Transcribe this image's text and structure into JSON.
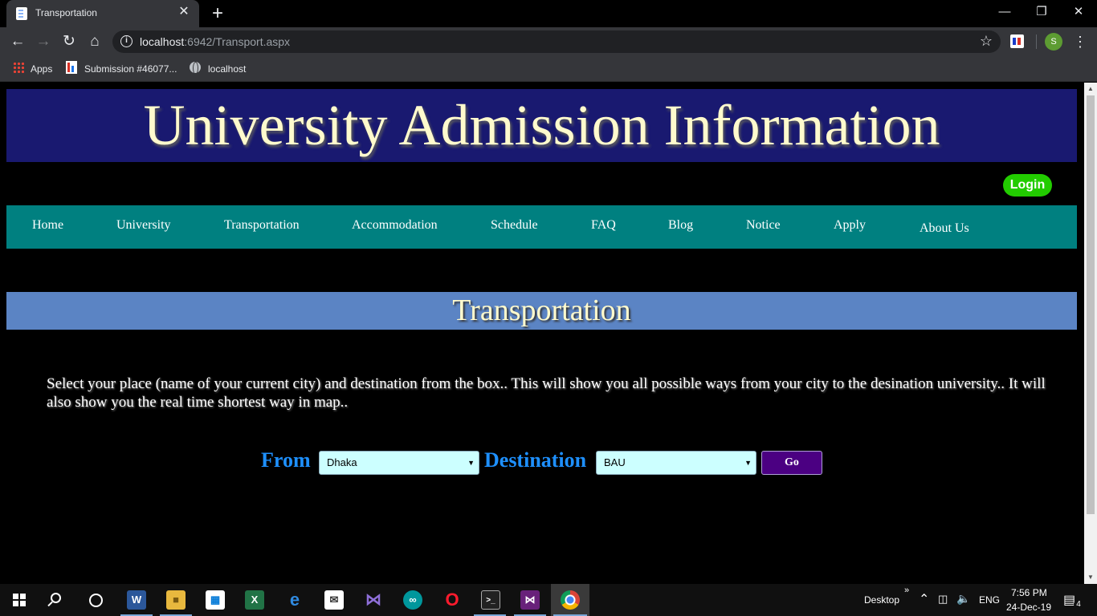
{
  "browser": {
    "tab_title": "Transportation",
    "tab_close": "✕",
    "new_tab": "+",
    "url_host": "localhost",
    "url_rest": ":6942/Transport.aspx",
    "bookmarks": {
      "apps": "Apps",
      "submission": "Submission #46077...",
      "localhost": "localhost"
    },
    "profile_initial": "S"
  },
  "page": {
    "banner_title": "University Admission Information",
    "login_label": "Login",
    "menu": [
      {
        "label": "Home"
      },
      {
        "label": "University"
      },
      {
        "label": "Transportation"
      },
      {
        "label": "Accommodation"
      },
      {
        "label": "Schedule"
      },
      {
        "label": "FAQ"
      },
      {
        "label": "Blog"
      },
      {
        "label": "Notice"
      },
      {
        "label": "Apply"
      },
      {
        "label": "About Us"
      }
    ],
    "section_title": "Transportation",
    "description": "Select your place (name of your current city) and destination from the box.. This will show you all possible ways from your city to the desination university.. It will also show you the real time shortest way in map..",
    "form": {
      "from_label": "From",
      "from_value": "Dhaka",
      "destination_label": "Destination",
      "destination_value": "BAU",
      "go_label": "Go"
    }
  },
  "taskbar": {
    "desktop_label": "Desktop",
    "chevron": "»",
    "language": "ENG",
    "time": "7:56 PM",
    "date": "24-Dec-19",
    "notification_count": "4"
  },
  "colors": {
    "banner_bg": "#191970",
    "banner_text": "#fffacd",
    "menu_bg": "#008080",
    "section_bg": "#5b84c4",
    "label_blue": "#1e90ff",
    "select_bg": "#ccffff",
    "go_bg": "#4b0082",
    "login_bg": "#22cc00"
  }
}
